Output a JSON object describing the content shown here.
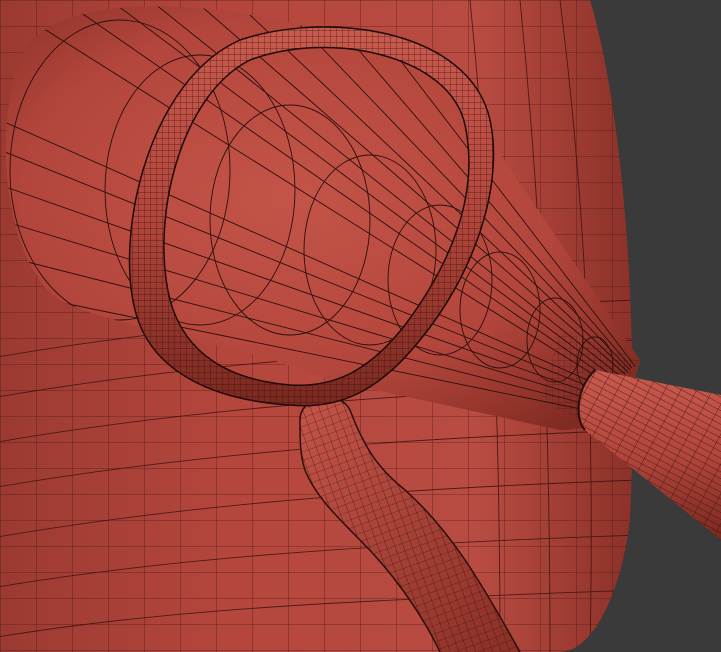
{
  "viewport": {
    "background_color": "#3a3a3a",
    "mesh_color": "#b44a40",
    "wire_color": "#2b0f0d",
    "shading": "polyframe-wireframe-over-clay"
  },
  "objects": [
    {
      "name": "body-surface",
      "kind": "large curved surface"
    },
    {
      "name": "cone-horn",
      "kind": "cone / funnel"
    },
    {
      "name": "torus-ring",
      "kind": "ring around cone"
    },
    {
      "name": "bent-tube",
      "kind": "curved tube"
    },
    {
      "name": "straight-tube",
      "kind": "tube extending from cone tip"
    }
  ]
}
